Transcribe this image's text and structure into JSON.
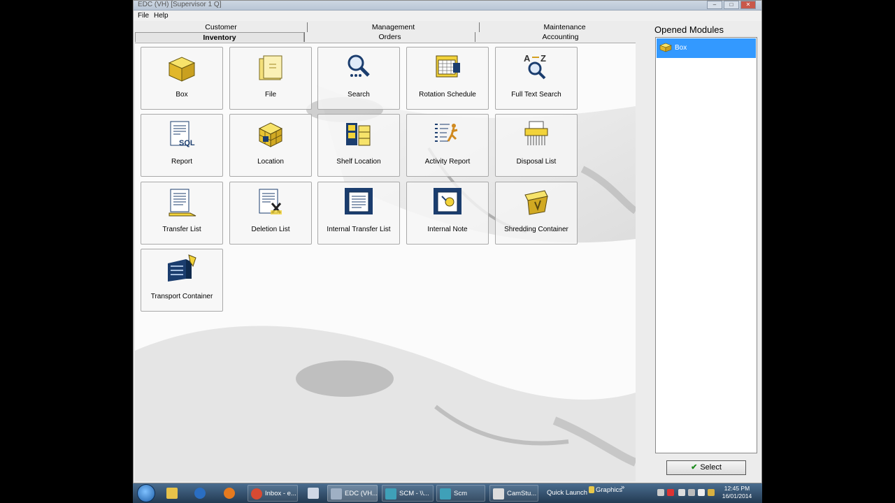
{
  "window": {
    "title": "EDC (VH) [Supervisor 1          Q]",
    "minimize_glyph": "–",
    "maximize_glyph": "□",
    "close_glyph": "✕"
  },
  "menu": {
    "file": "File",
    "help": "Help"
  },
  "tabs": {
    "row1": [
      "Customer",
      "Management",
      "Maintenance"
    ],
    "row2": [
      "Inventory",
      "Orders",
      "Accounting"
    ],
    "active": "Inventory"
  },
  "tiles": [
    {
      "label": "Box",
      "icon": "box-icon"
    },
    {
      "label": "File",
      "icon": "folder-icon"
    },
    {
      "label": "Search",
      "icon": "magnifier-icon"
    },
    {
      "label": "Rotation Schedule",
      "icon": "calendar-icon"
    },
    {
      "label": "Full Text Search",
      "icon": "az-search-icon"
    },
    {
      "label": "Report",
      "icon": "sql-report-icon"
    },
    {
      "label": "Location",
      "icon": "location-cube-icon"
    },
    {
      "label": "Shelf Location",
      "icon": "shelf-icon"
    },
    {
      "label": "Activity Report",
      "icon": "runner-list-icon"
    },
    {
      "label": "Disposal List",
      "icon": "shredder-icon"
    },
    {
      "label": "Transfer List",
      "icon": "transfer-doc-icon"
    },
    {
      "label": "Deletion List",
      "icon": "deletion-doc-icon"
    },
    {
      "label": "Internal Transfer List",
      "icon": "internal-transfer-icon"
    },
    {
      "label": "Internal Note",
      "icon": "internal-note-icon"
    },
    {
      "label": "Shredding Container",
      "icon": "shred-container-icon"
    },
    {
      "label": "Transport Container",
      "icon": "transport-container-icon"
    }
  ],
  "side": {
    "title": "Opened Modules",
    "modules": [
      {
        "label": "Box",
        "icon": "box-icon"
      }
    ],
    "select_label": "Select",
    "select_glyph": "✔"
  },
  "taskbar": {
    "items": [
      "Inbox - e...",
      "EDC (VH...",
      "SCM - \\\\...",
      "Scm",
      "CamStu..."
    ],
    "quick_launch": "Quick Launch",
    "graphics": "Graphics",
    "chevron": "»",
    "time": "12:45 PM",
    "date": "16/01/2014"
  },
  "colors": {
    "selection": "#3399ff",
    "taskbar": "#2f4d6b",
    "icon_yellow": "#f2d33a",
    "icon_navy": "#1b3d6e"
  }
}
